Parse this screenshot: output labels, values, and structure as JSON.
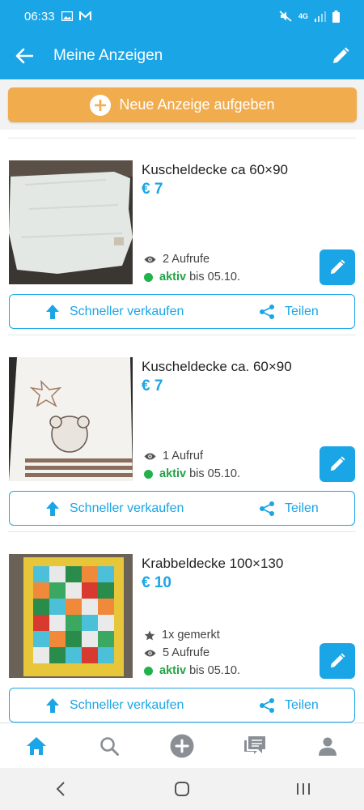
{
  "status_bar": {
    "time": "06:33",
    "network": "4G"
  },
  "app_bar": {
    "title": "Meine Anzeigen"
  },
  "new_ad": {
    "label": "Neue Anzeige aufgeben"
  },
  "ads": [
    {
      "title": "Kuscheldecke ca 60×90",
      "price": "€ 7",
      "views": "2 Aufrufe",
      "status": "aktiv",
      "status_until": "bis 05.10.",
      "sell_label": "Schneller verkaufen",
      "share_label": "Teilen"
    },
    {
      "title": "Kuscheldecke ca. 60×90",
      "price": "€ 7",
      "views": "1 Aufruf",
      "status": "aktiv",
      "status_until": "bis 05.10.",
      "sell_label": "Schneller verkaufen",
      "share_label": "Teilen"
    },
    {
      "title": "Krabbeldecke 100×130",
      "price": "€ 10",
      "saved": "1x gemerkt",
      "views": "5 Aufrufe",
      "status": "aktiv",
      "status_until": "bis 05.10.",
      "sell_label": "Schneller verkaufen",
      "share_label": "Teilen"
    }
  ],
  "bottom_nav": {
    "items": [
      "home-icon",
      "search-icon",
      "add-circle-icon",
      "messages-icon",
      "profile-icon"
    ],
    "active": "home-icon"
  },
  "colors": {
    "primary": "#1aa5e6",
    "orange": "#f1ac4e",
    "active_green": "#22b24c"
  }
}
